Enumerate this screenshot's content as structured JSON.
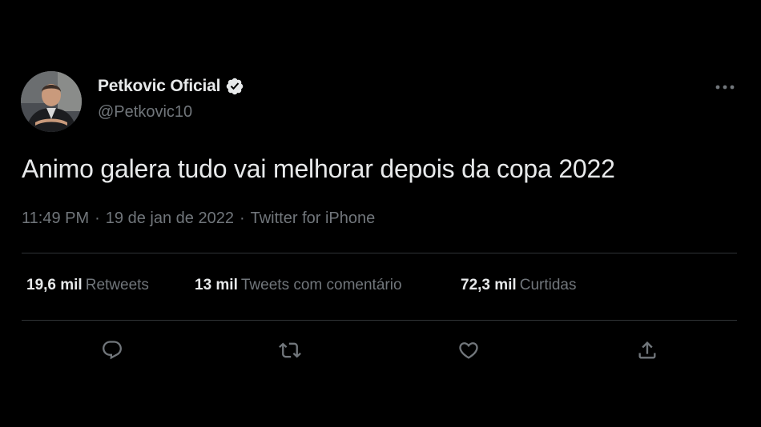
{
  "author": {
    "display_name": "Petkovic Oficial",
    "handle": "@Petkovic10",
    "verified": true
  },
  "tweet": {
    "text": "Animo galera tudo vai melhorar depois da copa 2022",
    "time": "11:49 PM",
    "date": "19 de jan de 2022",
    "source": "Twitter for iPhone",
    "separator": "·"
  },
  "stats": {
    "retweets": {
      "count": "19,6 mil",
      "label": "Retweets"
    },
    "quotes": {
      "count": "13 mil",
      "label": "Tweets com comentário"
    },
    "likes": {
      "count": "72,3 mil",
      "label": "Curtidas"
    }
  },
  "icons": {
    "verified": "verified-badge-icon",
    "more": "more-options-icon",
    "reply": "reply-icon",
    "retweet": "retweet-icon",
    "like": "heart-icon",
    "share": "share-icon"
  },
  "colors": {
    "background": "#000000",
    "primary_text": "#e7e9ea",
    "secondary_text": "#71767b",
    "divider": "#2f3336",
    "verified_badge": "#e7e9ea"
  }
}
